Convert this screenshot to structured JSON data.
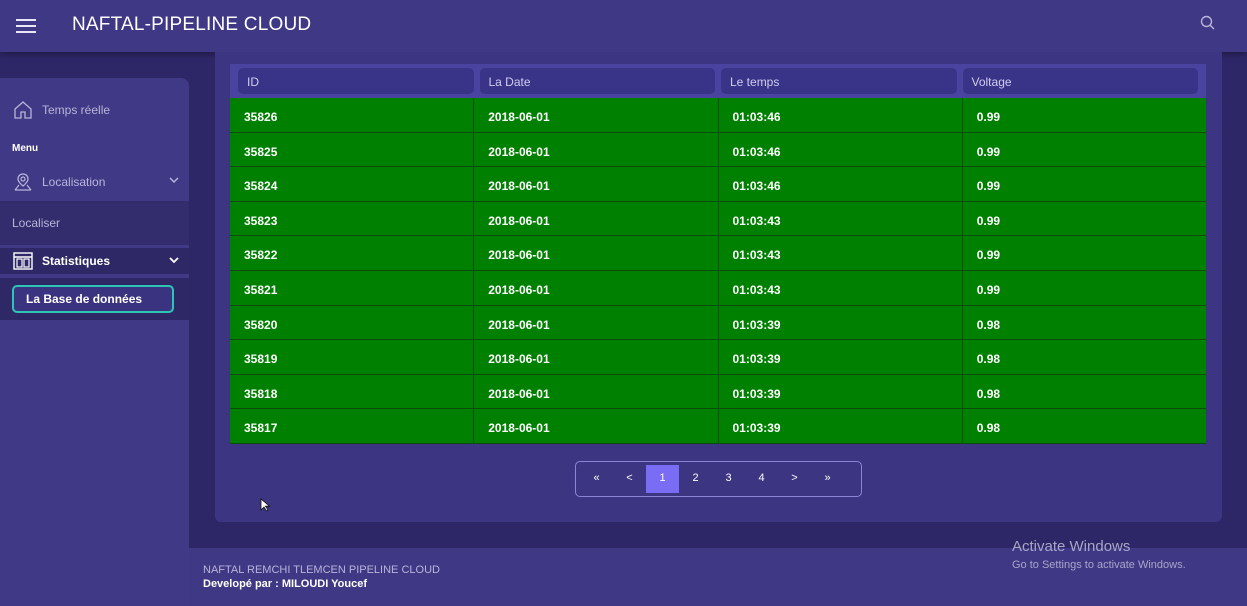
{
  "header": {
    "title": "NAFTAL-PIPELINE CLOUD",
    "menu_icon": "hamburger-icon",
    "search_icon": "search-icon"
  },
  "sidebar": {
    "home_label": "Temps réelle",
    "menu_heading": "Menu",
    "localisation_label": "Localisation",
    "localiser_label": "Localiser",
    "statistiques_label": "Statistiques",
    "database_label": "La Base de données"
  },
  "table": {
    "headers": [
      "ID",
      "La Date",
      "Le temps",
      "Voltage"
    ],
    "rows": [
      [
        "35826",
        "2018-06-01",
        "01:03:46",
        "0.99"
      ],
      [
        "35825",
        "2018-06-01",
        "01:03:46",
        "0.99"
      ],
      [
        "35824",
        "2018-06-01",
        "01:03:46",
        "0.99"
      ],
      [
        "35823",
        "2018-06-01",
        "01:03:43",
        "0.99"
      ],
      [
        "35822",
        "2018-06-01",
        "01:03:43",
        "0.99"
      ],
      [
        "35821",
        "2018-06-01",
        "01:03:43",
        "0.99"
      ],
      [
        "35820",
        "2018-06-01",
        "01:03:39",
        "0.98"
      ],
      [
        "35819",
        "2018-06-01",
        "01:03:39",
        "0.98"
      ],
      [
        "35818",
        "2018-06-01",
        "01:03:39",
        "0.98"
      ],
      [
        "35817",
        "2018-06-01",
        "01:03:39",
        "0.98"
      ]
    ],
    "row_color": "#008000"
  },
  "pagination": {
    "first": "«",
    "prev": "<",
    "pages": [
      "1",
      "2",
      "3",
      "4"
    ],
    "next": ">",
    "last": "»",
    "current": "1"
  },
  "footer": {
    "line1": "NAFTAL REMCHI TLEMCEN PIPELINE CLOUD",
    "line2": "Developé par : MILOUDI Youcef"
  },
  "watermark": {
    "title": "Activate Windows",
    "subtitle": "Go to Settings to activate Windows."
  },
  "colors": {
    "accent": "#7b6cf6",
    "teal": "#2ec4b6",
    "background": "#2d2767"
  }
}
